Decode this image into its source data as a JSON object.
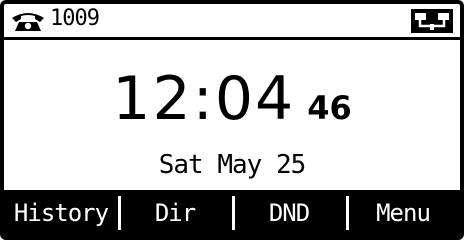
{
  "status": {
    "account": "1009",
    "phone_icon": "phone-handset-icon",
    "network_icon": "network-icon"
  },
  "clock": {
    "time": "12:04",
    "seconds": "46"
  },
  "date": "Sat May 25",
  "softkeys": [
    {
      "label": "History"
    },
    {
      "label": "Dir"
    },
    {
      "label": "DND"
    },
    {
      "label": "Menu"
    }
  ]
}
